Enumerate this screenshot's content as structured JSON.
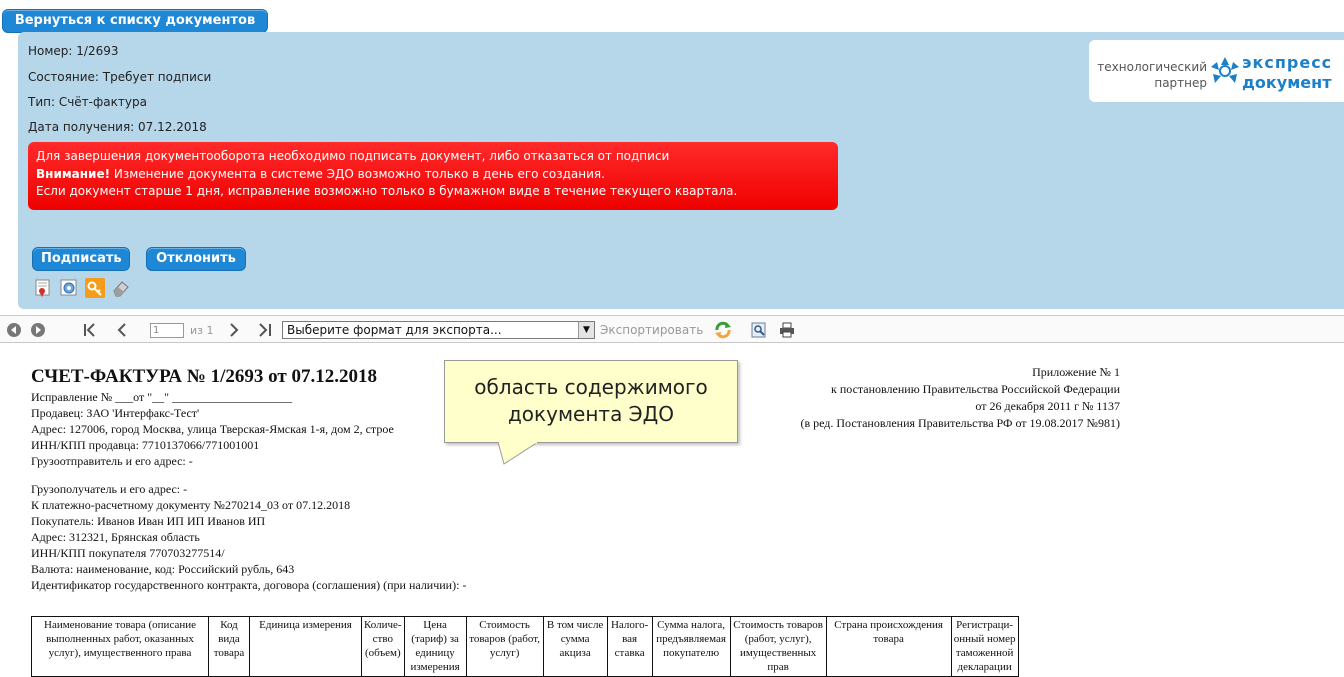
{
  "header": {
    "back_label": "Вернуться к списку документов"
  },
  "meta": {
    "number": "Номер: 1/2693",
    "state": "Состояние: Требует подписи",
    "type": "Тип: Счёт-фактура",
    "received": "Дата получения: 07.12.2018"
  },
  "alert": {
    "line1": "Для завершения документооборота необходимо подписать документ, либо отказаться от подписи",
    "line2_bold": "Внимание!",
    "line2_rest": " Изменение документа в системе ЭДО возможно только в день его создания.",
    "line3": "Если документ старше 1 дня, исправление возможно только в бумажном виде в течение текущего квартала."
  },
  "logo": {
    "line1": "технологический",
    "line2": "партнер",
    "brand1": "экспресс",
    "brand2": "документ"
  },
  "actions": {
    "sign_label": "Подписать",
    "reject_label": "Отклонить"
  },
  "tool_icons": [
    "certificate-icon",
    "stamp-icon",
    "key-icon",
    "eraser-icon"
  ],
  "toolbar": {
    "page_value": "1",
    "page_of": "из 1",
    "export_placeholder": "Выберите формат для экспорта...",
    "export_label": "Экспортировать"
  },
  "document": {
    "title": "СЧЕТ-ФАКТУРА № 1/2693 от 07.12.2018",
    "correction": "Исправление №  ___от \"__\" ____________________",
    "seller": "Продавец: ЗАО 'Интерфакс-Тест'",
    "address": "Адрес: 127006, город Москва, улица Тверская-Ямская 1-я, дом 2, строе",
    "inn": "ИНН/КПП продавца: 7710137066/771001001",
    "shipper": "Грузоотправитель и его адрес: -",
    "consignee": "Грузополучатель и его адрес: -",
    "payment": "К платежно-расчетному документу №270214_03 от 07.12.2018",
    "buyer": "Покупатель: Иванов Иван ИП ИП Иванов ИП",
    "buyer_address": "Адрес: 312321, Брянская область",
    "buyer_inn": "ИНН/КПП покупателя 770703277514/",
    "currency": "Валюта: наименование, код: Российский рубль, 643",
    "contract": "Идентификатор государственного контракта, договора (соглашения) (при наличии): -",
    "annex1": "Приложение № 1",
    "annex2": "к постановлению Правительства Российской Федерации",
    "annex3": "от 26 декабря 2011 г № 1137",
    "annex4": "(в ред. Постановления Правительства РФ от 19.08.2017 №981)"
  },
  "callout": {
    "line1": "область содержимого",
    "line2": "документа ЭДО"
  },
  "table_headers": [
    "Наименование товара (описание выполненных работ, оказанных услуг), имущественного права",
    "Код вида товара",
    "Единица измерения",
    "Количе-ство (объем)",
    "Цена (тариф) за единицу измерения",
    "Стоимость товаров (работ, услуг)",
    "В том числе сумма акциза",
    "Налого-вая ставка",
    "Сумма налога, предъявляемая покупателю",
    "Стоимость товаров (работ, услуг), имущественных прав",
    "Страна происхождения товара",
    "Регистраци-онный номер таможенной декларации"
  ]
}
